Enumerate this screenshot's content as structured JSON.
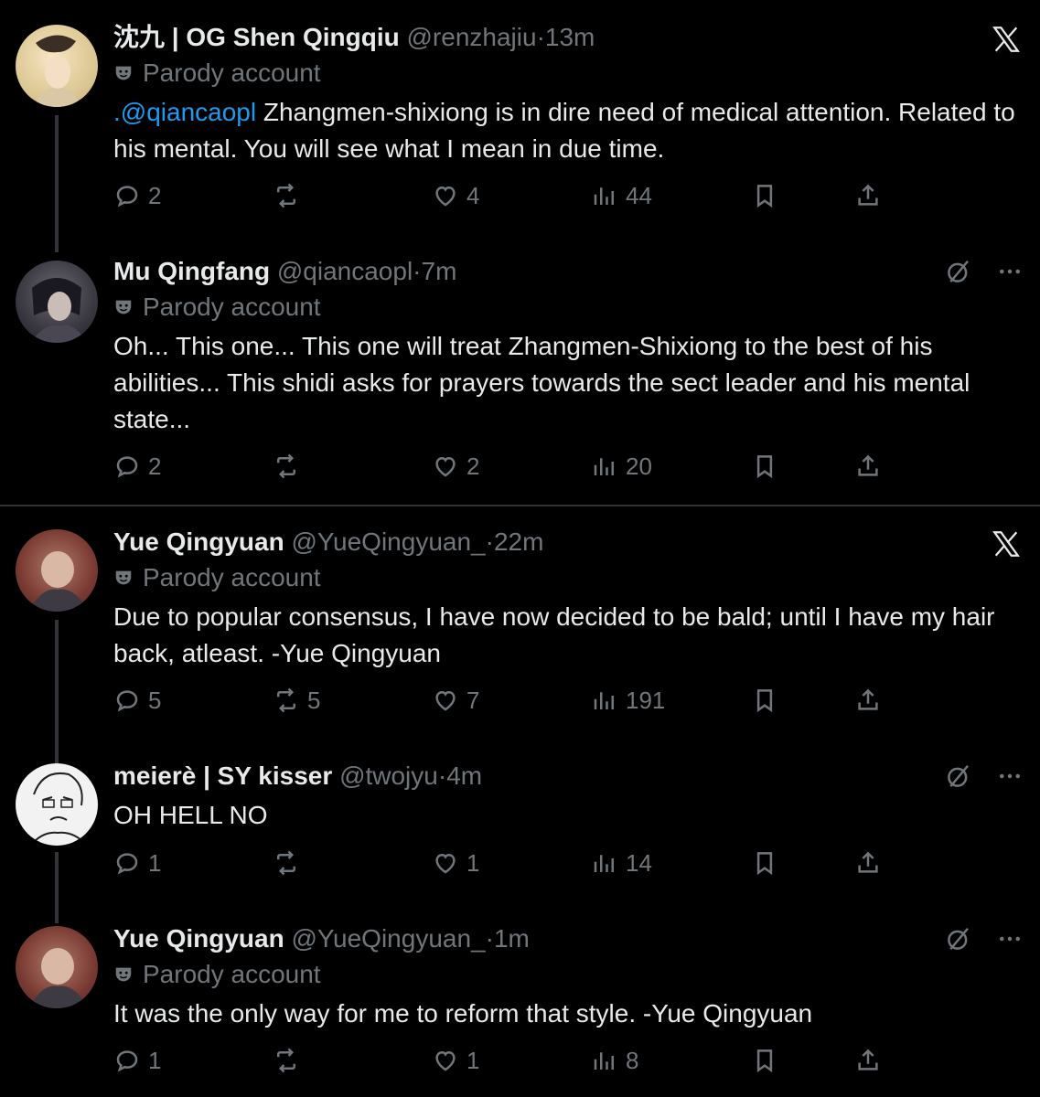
{
  "tweets": [
    {
      "name": "沈九 | OG Shen Qingqiu",
      "handle": "@renzhajiu",
      "time": "13m",
      "parody": "Parody account",
      "mention": ".@qiancaopl",
      "text": " Zhangmen-shixiong is in dire need of medical attention. Related to his mental. You will see what I mean in due time.",
      "replies": "2",
      "reposts": "",
      "likes": "4",
      "views": "44"
    },
    {
      "name": "Mu Qingfang",
      "handle": "@qiancaopl",
      "time": "7m",
      "parody": "Parody account",
      "text": "Oh... This one... This one will treat Zhangmen-Shixiong to the best of his abilities... This shidi asks for prayers towards the sect leader and his mental state...",
      "replies": "2",
      "reposts": "",
      "likes": "2",
      "views": "20"
    },
    {
      "name": "Yue Qingyuan",
      "handle": "@YueQingyuan_",
      "time": "22m",
      "parody": "Parody account",
      "text": "Due to popular consensus, I have now decided to be bald; until I have my hair back, atleast. -Yue Qingyuan",
      "replies": "5",
      "reposts": "5",
      "likes": "7",
      "views": "191"
    },
    {
      "name": "meierè | SY kisser",
      "handle": "@twojyu",
      "time": "4m",
      "text": "OH HELL NO",
      "replies": "1",
      "reposts": "",
      "likes": "1",
      "views": "14"
    },
    {
      "name": "Yue Qingyuan",
      "handle": "@YueQingyuan_",
      "time": "1m",
      "parody": "Parody account",
      "text": "It was the only way for me to reform that style. -Yue Qingyuan",
      "replies": "1",
      "reposts": "",
      "likes": "1",
      "views": "8"
    }
  ],
  "separator": "·",
  "colors": {
    "background": "#000000",
    "text": "#e7e9ea",
    "muted": "#71767b",
    "link": "#1d9bf0",
    "line": "#333639"
  },
  "icons": [
    "x-logo-icon",
    "grok-icon",
    "more-icon",
    "reply-icon",
    "repost-icon",
    "like-icon",
    "views-icon",
    "bookmark-icon",
    "share-icon",
    "parody-mask-icon"
  ]
}
